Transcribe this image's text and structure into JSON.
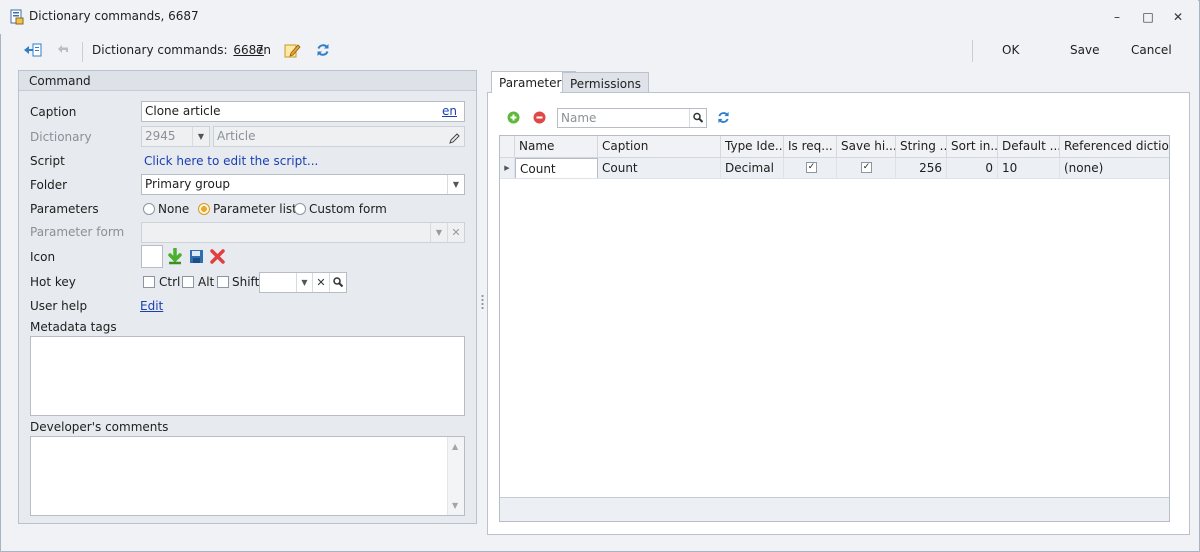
{
  "window": {
    "title": "Dictionary commands, 6687",
    "controls": {
      "minimize": "–",
      "maximize": "□",
      "close": "✕"
    }
  },
  "toolbar": {
    "breadcrumb_label": "Dictionary commands:",
    "record_id": "6687",
    "language": "en",
    "ok_label": "OK",
    "save_label": "Save",
    "cancel_label": "Cancel"
  },
  "command": {
    "group_title": "Command",
    "caption_label": "Caption",
    "caption_value": "Clone article",
    "caption_lang": "en",
    "dictionary_label": "Dictionary",
    "dictionary_id": "2945",
    "dictionary_name": "Article",
    "script_label": "Script",
    "script_link": "Click here to edit the script...",
    "folder_label": "Folder",
    "folder_value": "Primary group",
    "parameters_label": "Parameters",
    "param_options": [
      "None",
      "Parameter list",
      "Custom form"
    ],
    "param_selected": "Parameter list",
    "parameter_form_label": "Parameter form",
    "parameter_form_value": "",
    "icon_label": "Icon",
    "hotkey_label": "Hot key",
    "hotkey_mods": [
      "Ctrl",
      "Alt",
      "Shift"
    ],
    "hotkey_value": "",
    "user_help_label": "User help",
    "user_help_link": "Edit",
    "metadata_tags_label": "Metadata tags",
    "metadata_tags_value": "",
    "dev_comments_label": "Developer's comments",
    "dev_comments_value": ""
  },
  "tabs": {
    "parameters": "Parameters",
    "permissions": "Permissions",
    "active": "Parameters"
  },
  "grid_toolbar": {
    "search_placeholder": "Name"
  },
  "grid": {
    "columns": [
      "Name",
      "Caption",
      "Type Ide...",
      "Is req...",
      "Save hi...",
      "String ...",
      "Sort in...",
      "Default ...",
      "Referenced dictio..."
    ],
    "rows": [
      {
        "name": "Count",
        "caption": "Count",
        "type": "Decimal",
        "is_required": true,
        "save_history": true,
        "string_length": "256",
        "sort_index": "0",
        "default": "10",
        "referenced_dictionary": "(none)"
      }
    ]
  },
  "colors": {
    "accent_link": "#1a3fb3",
    "add_icon": "#4caf2f",
    "remove_icon": "#e04040",
    "refresh_icon": "#2f7fc8"
  }
}
